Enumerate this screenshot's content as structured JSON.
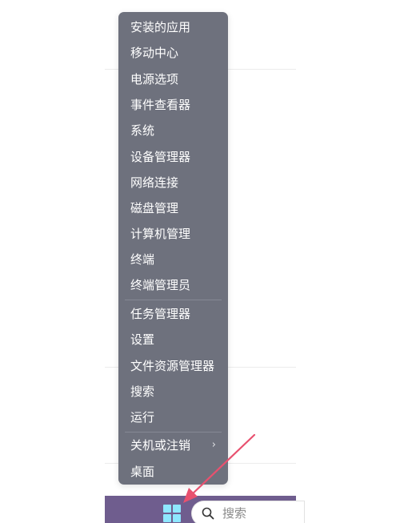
{
  "menu": {
    "items": [
      {
        "label": "安装的应用"
      },
      {
        "label": "移动中心"
      },
      {
        "label": "电源选项"
      },
      {
        "label": "事件查看器"
      },
      {
        "label": "系统"
      },
      {
        "label": "设备管理器"
      },
      {
        "label": "网络连接"
      },
      {
        "label": "磁盘管理"
      },
      {
        "label": "计算机管理"
      },
      {
        "label": "终端"
      },
      {
        "label": "终端管理员"
      },
      {
        "label": "任务管理器"
      },
      {
        "label": "设置"
      },
      {
        "label": "文件资源管理器"
      },
      {
        "label": "搜索"
      },
      {
        "label": "运行"
      },
      {
        "label": "关机或注销"
      },
      {
        "label": "桌面"
      }
    ],
    "submenu_chevron": "›"
  },
  "taskbar": {
    "search_label": "搜索"
  },
  "colors": {
    "menu_bg": "#6e717d",
    "menu_text": "#ffffff",
    "taskbar_bg": "#6f5d8e",
    "windows_logo": "#8ee7ff",
    "arrow": "#e8516f"
  },
  "icons": {
    "start": "windows-logo-icon",
    "search": "search-icon",
    "submenu": "chevron-right-icon",
    "annotation": "red-arrow-icon"
  }
}
